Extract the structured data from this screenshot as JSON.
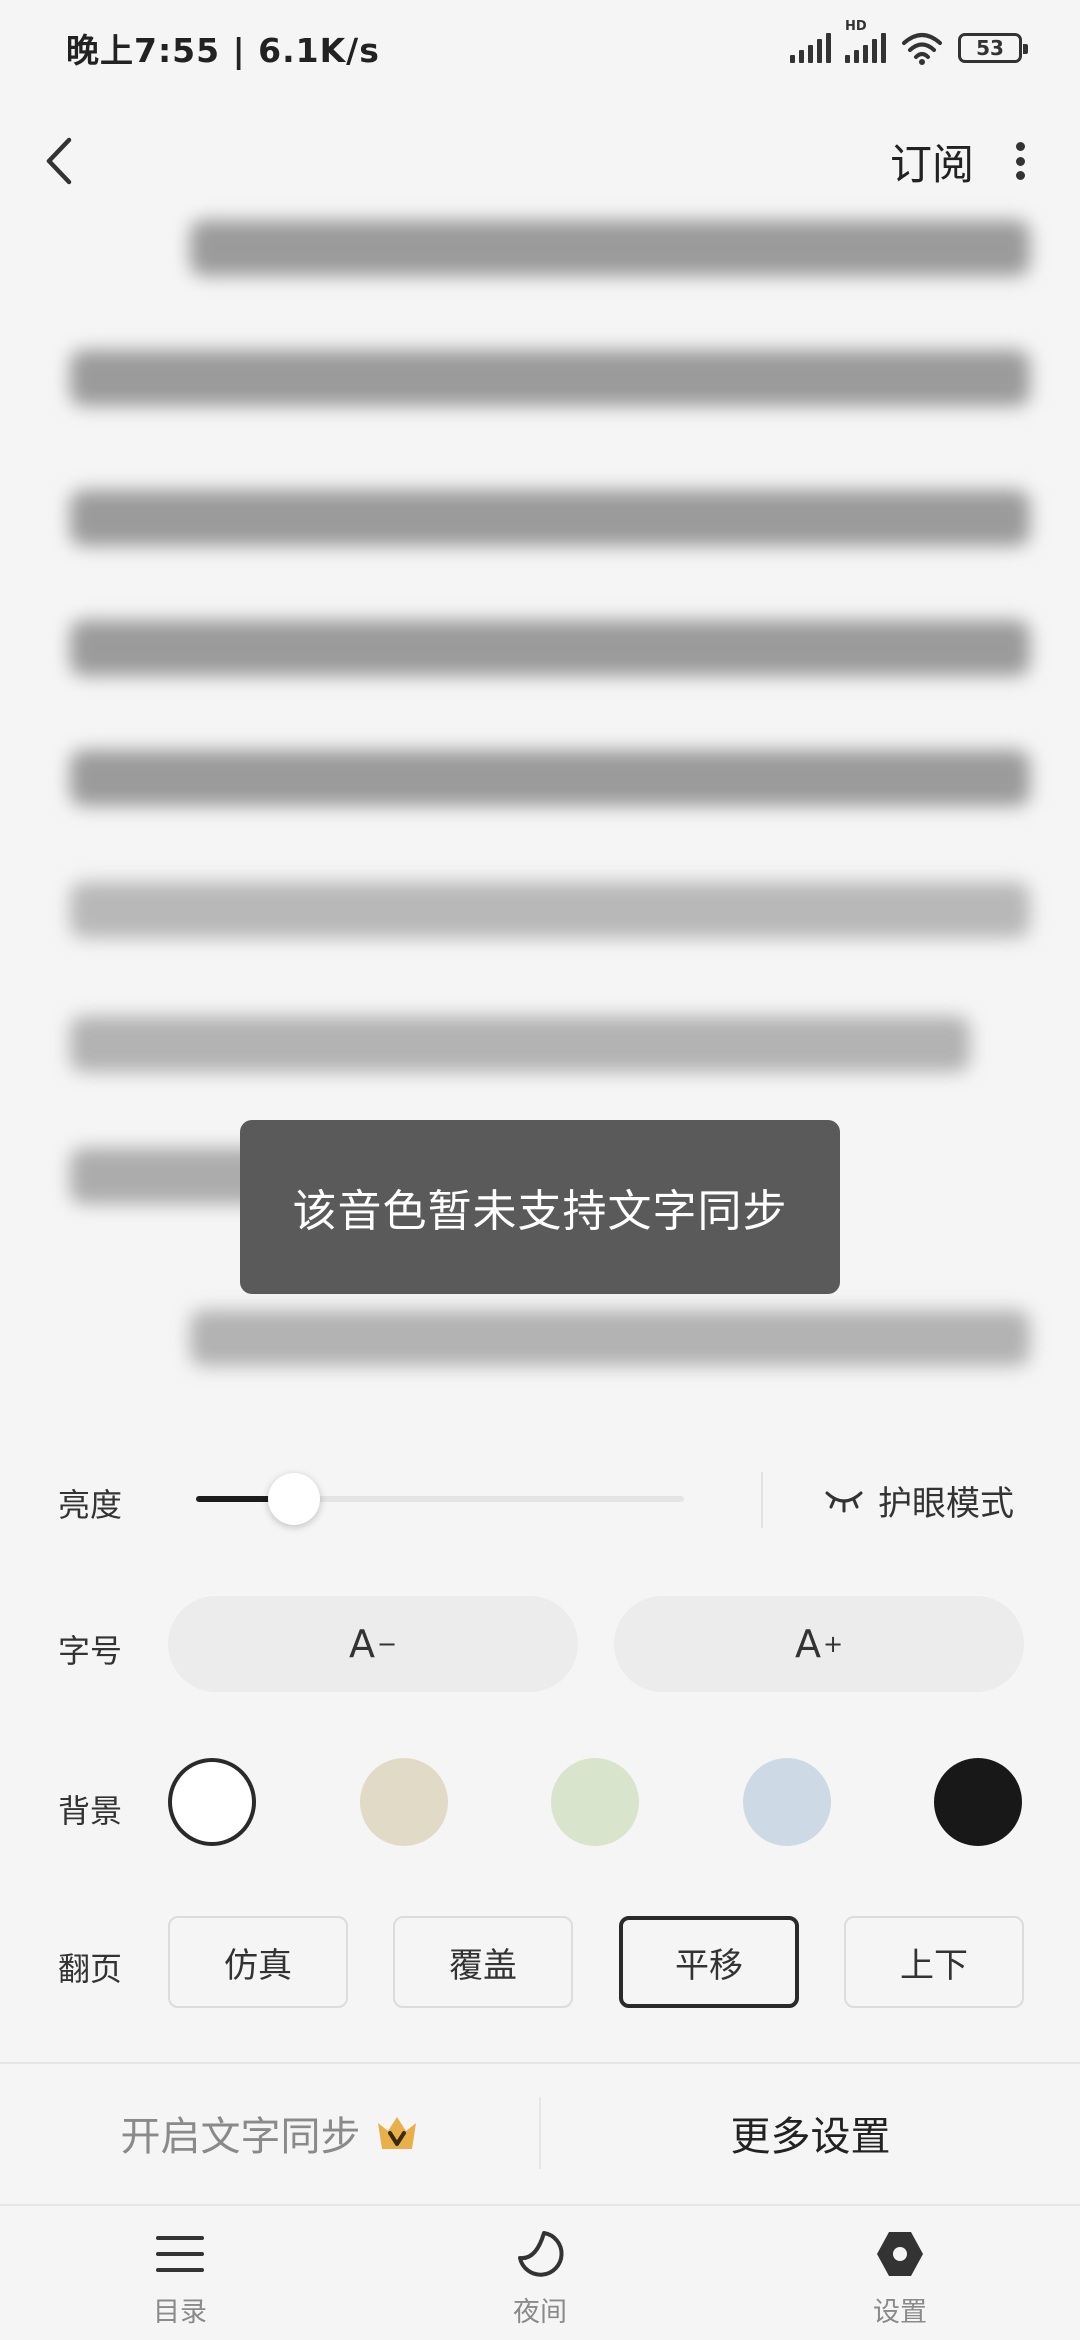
{
  "status_bar": {
    "time_speed": "晚上7:55 | 6.1K/s",
    "hd_label": "HD",
    "battery": "53"
  },
  "header": {
    "subscribe_label": "订阅"
  },
  "toast": {
    "message": "该音色暂未支持文字同步"
  },
  "settings": {
    "brightness_label": "亮度",
    "brightness_level": 0.2,
    "eye_mode_label": "护眼模式",
    "font_size_label": "字号",
    "font_decrease_label": "A",
    "font_decrease_mark": "−",
    "font_increase_label": "A",
    "font_increase_mark": "+",
    "background_label": "背景",
    "background_colors": [
      "#ffffff",
      "#e1dac6",
      "#d9e4cc",
      "#cdd9e4",
      "#181818"
    ],
    "background_selected": 0,
    "page_turn_label": "翻页",
    "page_turn_options": [
      "仿真",
      "覆盖",
      "平移",
      "上下"
    ],
    "page_turn_selected": 2
  },
  "actions": {
    "sync_label": "开启文字同步",
    "more_settings_label": "更多设置"
  },
  "tabs": [
    {
      "label": "目录",
      "icon": "menu-icon"
    },
    {
      "label": "夜间",
      "icon": "moon-icon"
    },
    {
      "label": "设置",
      "icon": "settings-hexagon-icon"
    }
  ],
  "colors": {
    "background": "#f5f5f5",
    "toast": "#5a5a5a",
    "accent_crown": "#e8b04a"
  }
}
